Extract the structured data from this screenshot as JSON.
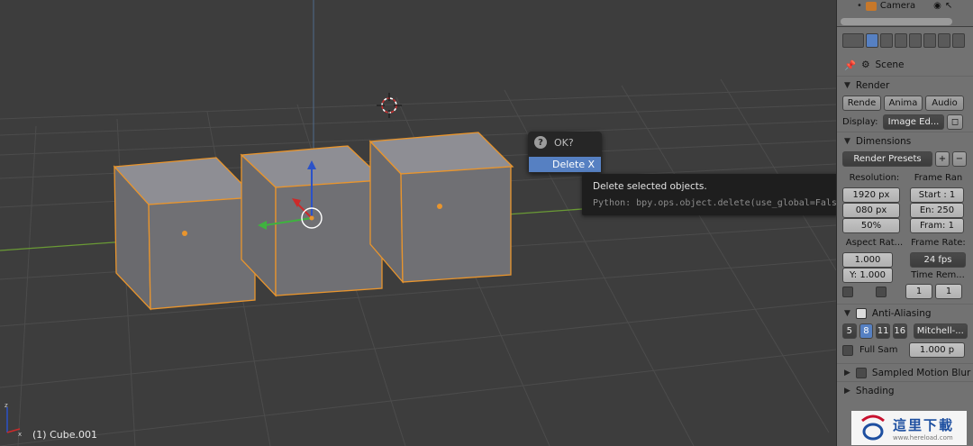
{
  "viewport": {
    "object_label": "(1) Cube.001",
    "mini_axis": {
      "x": "x",
      "z": "z"
    }
  },
  "popup": {
    "title": "OK?",
    "delete_label": "Delete",
    "shortcut": "X"
  },
  "tooltip": {
    "description": "Delete selected objects.",
    "python": "Python: bpy.ops.object.delete(use_global=False)"
  },
  "outliner": {
    "camera_label": "Camera"
  },
  "properties": {
    "context_label": "Scene",
    "render": {
      "title": "Render",
      "buttons": [
        "Rende",
        "Anima",
        "Audio"
      ],
      "display_label": "Display:",
      "display_value": "Image Ed..."
    },
    "dimensions": {
      "title": "Dimensions",
      "presets": "Render Presets",
      "resolution_label": "Resolution:",
      "frame_range_label": "Frame Ran",
      "res_x": "1920 px",
      "res_y": "080 px",
      "res_pct": "50%",
      "start": "Start : 1",
      "end": "En: 250",
      "frame": "Fram: 1",
      "aspect_label": "Aspect Rat...",
      "frame_rate_label": "Frame Rate:",
      "aspect_x": "1.000",
      "aspect_y": "Y: 1.000",
      "fps": "24 fps",
      "time_label": "Time Rem...",
      "time_old": "1",
      "time_new": "1"
    },
    "antialiasing": {
      "title": "Anti-Aliasing",
      "samples": [
        "5",
        "8",
        "11",
        "16"
      ],
      "selected_sample": "8",
      "filter": "Mitchell-...",
      "full_sample_label": "Full Sam",
      "filter_size": "1.000 p"
    },
    "motion_blur": {
      "title": "Sampled Motion Blur"
    },
    "shading": {
      "title": "Shading"
    }
  },
  "watermark": {
    "text": "這里下載",
    "url": "www.hereload.com"
  },
  "colors": {
    "selection": "#e9952d",
    "accent": "#5680c2"
  }
}
